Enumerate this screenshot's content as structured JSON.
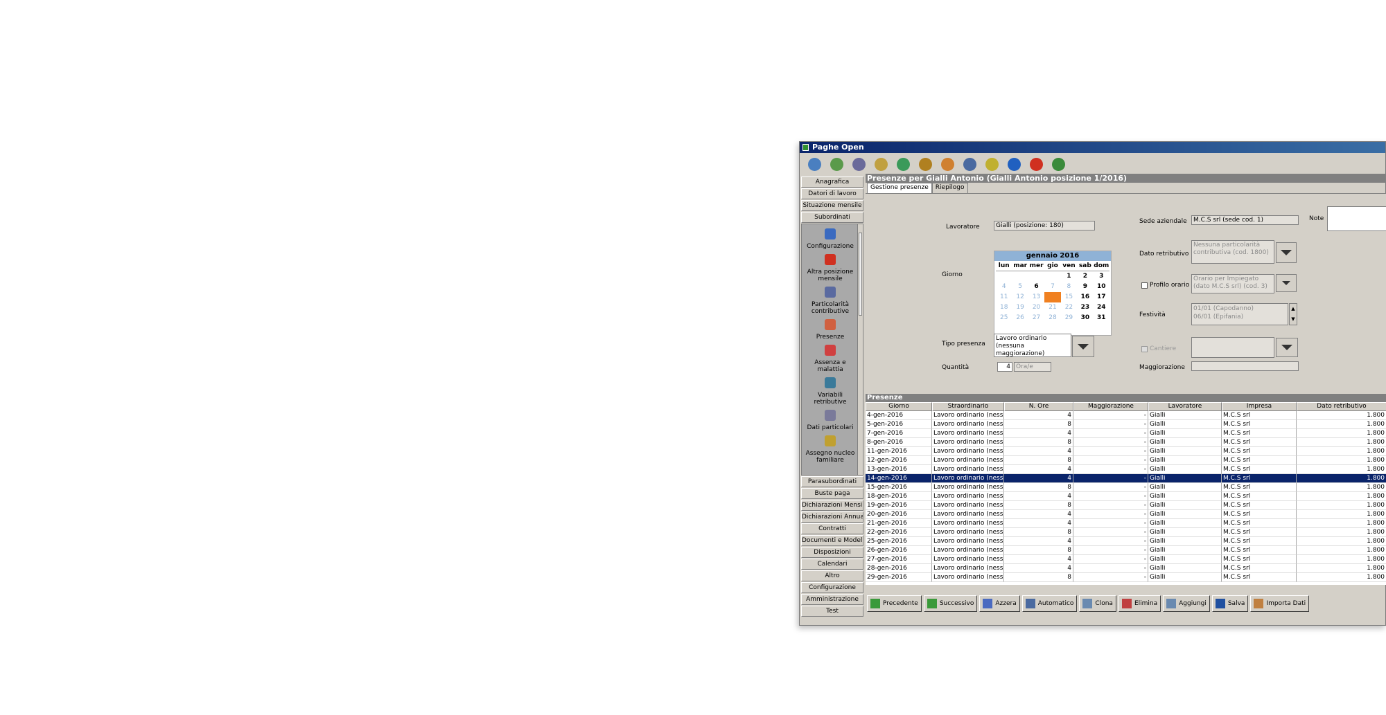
{
  "window": {
    "title": "Paghe Open"
  },
  "toolbar": {
    "icons": [
      "home-icon",
      "globe-icon",
      "users-icon",
      "search-doc-icon",
      "help-icon",
      "bug-icon",
      "user-icon",
      "network-icon",
      "folder-icon",
      "info-icon",
      "close-icon",
      "plugin-icon"
    ]
  },
  "nav": {
    "top": [
      "Anagrafica",
      "Datori di lavoro",
      "Situazione mensile",
      "Subordinati"
    ],
    "sub": [
      {
        "label": "Configurazione",
        "icon": "person-icon"
      },
      {
        "label": "Altra posizione mensile",
        "icon": "target-icon"
      },
      {
        "label": "Particolarità contributive",
        "icon": "percent-icon"
      },
      {
        "label": "Presenze",
        "icon": "calendar-icon"
      },
      {
        "label": "Assenza e malattia",
        "icon": "calendar-alert-icon"
      },
      {
        "label": "Variabili retributive",
        "icon": "chart-icon"
      },
      {
        "label": "Dati particolari",
        "icon": "cart-icon"
      },
      {
        "label": "Assegno nucleo familiare",
        "icon": "family-icon"
      }
    ],
    "bottom": [
      "Parasubordinati",
      "Buste paga",
      "Dichiarazioni Mensili",
      "Dichiarazioni Annuali",
      "Contratti",
      "Documenti e Modelli",
      "Disposizioni",
      "Calendari",
      "Altro",
      "Configurazione",
      "Amministrazione",
      "Test"
    ]
  },
  "header": {
    "title": "Presenze per Gialli Antonio (Gialli Antonio posizione 1/2016)"
  },
  "tabs": [
    "Gestione presenze",
    "Riepilogo"
  ],
  "form": {
    "lavoratore_label": "Lavoratore",
    "lavoratore_value": "Gialli (posizione: 180)",
    "giorno_label": "Giorno",
    "tipo_presenza_label": "Tipo presenza",
    "tipo_presenza_value": "Lavoro ordinario (nessuna maggiorazione)",
    "quantita_label": "Quantità",
    "quantita_value": "4",
    "unit_value": "Ora/e",
    "sede_label": "Sede aziendale",
    "sede_value": "M.C.S srl (sede cod. 1)",
    "note_label": "Note",
    "dato_label": "Dato retributivo",
    "dato_value": "Nessuna particolarità contributiva (cod. 1800)",
    "profilo_label": "Profilo orario",
    "profilo_value": "Orario per Impiegato (dato M.C.S srl) (cod. 3)",
    "festivita_label": "Festività",
    "festivita_value_1": "01/01 (Capodanno)",
    "festivita_value_2": "06/01 (Epifania)",
    "cantiere_label": "Cantiere",
    "maggiorazione_label": "Maggiorazione"
  },
  "calendar": {
    "month": "gennaio 2016",
    "days": [
      "lun",
      "mar",
      "mer",
      "gio",
      "ven",
      "sab",
      "dom"
    ],
    "cells": [
      "",
      "",
      "",
      "",
      "1",
      "2",
      "3",
      "4",
      "5",
      "6",
      "7",
      "8",
      "9",
      "10",
      "11",
      "12",
      "13",
      "14",
      "15",
      "16",
      "17",
      "18",
      "19",
      "20",
      "21",
      "22",
      "23",
      "24",
      "25",
      "26",
      "27",
      "28",
      "29",
      "30",
      "31"
    ],
    "selected": "14"
  },
  "table": {
    "section": "Presenze",
    "columns": [
      "Giorno",
      "Straordinario",
      "N. Ore",
      "Maggiorazione",
      "Lavoratore",
      "Impresa",
      "Dato retributivo"
    ],
    "rows": [
      [
        "4-gen-2016",
        "Lavoro ordinario (ness...",
        "4",
        "-",
        "Gialli",
        "M.C.S srl",
        "1.800"
      ],
      [
        "5-gen-2016",
        "Lavoro ordinario (ness...",
        "8",
        "-",
        "Gialli",
        "M.C.S srl",
        "1.800"
      ],
      [
        "7-gen-2016",
        "Lavoro ordinario (ness...",
        "4",
        "-",
        "Gialli",
        "M.C.S srl",
        "1.800"
      ],
      [
        "8-gen-2016",
        "Lavoro ordinario (ness...",
        "8",
        "-",
        "Gialli",
        "M.C.S srl",
        "1.800"
      ],
      [
        "11-gen-2016",
        "Lavoro ordinario (ness...",
        "4",
        "-",
        "Gialli",
        "M.C.S srl",
        "1.800"
      ],
      [
        "12-gen-2016",
        "Lavoro ordinario (ness...",
        "8",
        "-",
        "Gialli",
        "M.C.S srl",
        "1.800"
      ],
      [
        "13-gen-2016",
        "Lavoro ordinario (ness...",
        "4",
        "-",
        "Gialli",
        "M.C.S srl",
        "1.800"
      ],
      [
        "14-gen-2016",
        "Lavoro ordinario (ness...",
        "4",
        "-",
        "Gialli",
        "M.C.S srl",
        "1.800"
      ],
      [
        "15-gen-2016",
        "Lavoro ordinario (ness...",
        "8",
        "-",
        "Gialli",
        "M.C.S srl",
        "1.800"
      ],
      [
        "18-gen-2016",
        "Lavoro ordinario (ness...",
        "4",
        "-",
        "Gialli",
        "M.C.S srl",
        "1.800"
      ],
      [
        "19-gen-2016",
        "Lavoro ordinario (ness...",
        "8",
        "-",
        "Gialli",
        "M.C.S srl",
        "1.800"
      ],
      [
        "20-gen-2016",
        "Lavoro ordinario (ness...",
        "4",
        "-",
        "Gialli",
        "M.C.S srl",
        "1.800"
      ],
      [
        "21-gen-2016",
        "Lavoro ordinario (ness...",
        "4",
        "-",
        "Gialli",
        "M.C.S srl",
        "1.800"
      ],
      [
        "22-gen-2016",
        "Lavoro ordinario (ness...",
        "8",
        "-",
        "Gialli",
        "M.C.S srl",
        "1.800"
      ],
      [
        "25-gen-2016",
        "Lavoro ordinario (ness...",
        "4",
        "-",
        "Gialli",
        "M.C.S srl",
        "1.800"
      ],
      [
        "26-gen-2016",
        "Lavoro ordinario (ness...",
        "8",
        "-",
        "Gialli",
        "M.C.S srl",
        "1.800"
      ],
      [
        "27-gen-2016",
        "Lavoro ordinario (ness...",
        "4",
        "-",
        "Gialli",
        "M.C.S srl",
        "1.800"
      ],
      [
        "28-gen-2016",
        "Lavoro ordinario (ness...",
        "4",
        "-",
        "Gialli",
        "M.C.S srl",
        "1.800"
      ],
      [
        "29-gen-2016",
        "Lavoro ordinario (ness...",
        "8",
        "-",
        "Gialli",
        "M.C.S srl",
        "1.800"
      ]
    ],
    "selected_row": 7
  },
  "actions": [
    {
      "label": "Precedente",
      "icon": "arrow-up-icon"
    },
    {
      "label": "Successivo",
      "icon": "arrow-down-icon"
    },
    {
      "label": "Azzera",
      "icon": "eraser-icon"
    },
    {
      "label": "Automatico",
      "icon": "auto-icon"
    },
    {
      "label": "Clona",
      "icon": "clone-icon"
    },
    {
      "label": "Elimina",
      "icon": "delete-icon"
    },
    {
      "label": "Aggiungi",
      "icon": "add-icon"
    },
    {
      "label": "Salva",
      "icon": "save-icon"
    },
    {
      "label": "Importa Dati",
      "icon": "import-icon"
    }
  ],
  "colors": {
    "accent": "#0a246a",
    "calendar_header": "#8fb2d6",
    "selected_day": "#f08020"
  }
}
